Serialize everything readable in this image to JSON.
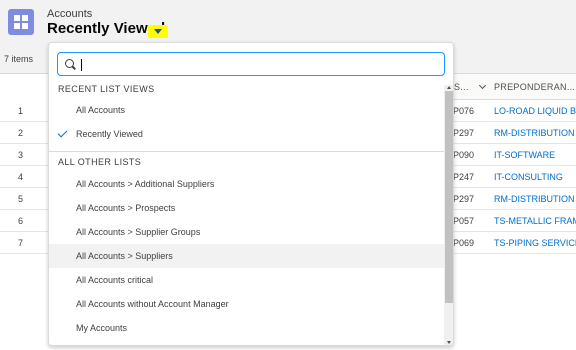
{
  "header": {
    "object_label": "Accounts",
    "list_title": "Recently Viewed",
    "items_count": "7 items",
    "icon": "account-grid-icon"
  },
  "columns": {
    "col_s": "S...",
    "col_preponderant": "PREPONDERAN..."
  },
  "rows": [
    {
      "num": "1",
      "code": "P076",
      "link": "LO-ROAD LIQUID B..."
    },
    {
      "num": "2",
      "code": "P297",
      "link": "RM-DISTRIBUTION"
    },
    {
      "num": "3",
      "code": "P090",
      "link": "IT-SOFTWARE"
    },
    {
      "num": "4",
      "code": "P247",
      "link": "IT-CONSULTING"
    },
    {
      "num": "5",
      "code": "P297",
      "link": "RM-DISTRIBUTION"
    },
    {
      "num": "6",
      "code": "P057",
      "link": "TS-METALLIC FRAM..."
    },
    {
      "num": "7",
      "code": "P069",
      "link": "TS-PIPING SERVICES"
    }
  ],
  "dropdown": {
    "search_value": "",
    "recent_header": "RECENT LIST VIEWS",
    "recent": [
      {
        "label": "All Accounts",
        "selected": false
      },
      {
        "label": "Recently Viewed",
        "selected": true
      }
    ],
    "other_header": "ALL OTHER LISTS",
    "other": [
      {
        "label": "All Accounts > Additional Suppliers"
      },
      {
        "label": "All Accounts > Prospects"
      },
      {
        "label": "All Accounts > Supplier Groups"
      },
      {
        "label": "All Accounts > Suppliers"
      },
      {
        "label": "All Accounts critical"
      },
      {
        "label": "All Accounts without Account Manager"
      },
      {
        "label": "My Accounts"
      }
    ]
  },
  "colors": {
    "accent": "#0176d3",
    "link": "#006dcc",
    "highlight": "#ffff00",
    "app_icon": "#7f8de1"
  }
}
